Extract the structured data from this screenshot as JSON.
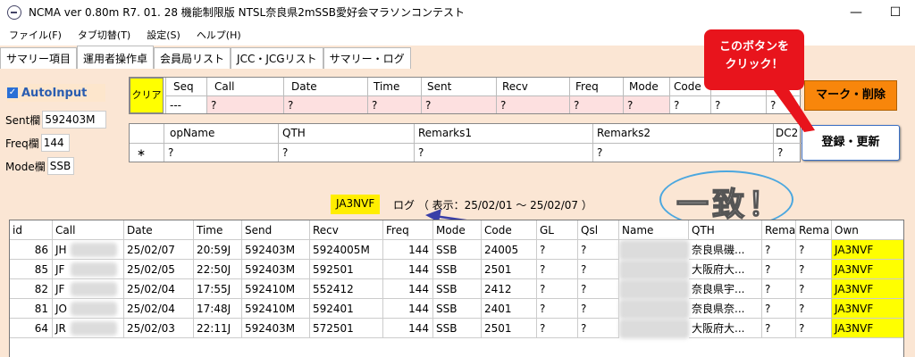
{
  "window": {
    "title": "NCMA ver 0.80m   R7. 01. 28 機能制限版 NTSL奈良県2mSSB愛好会マラソンコンテスト",
    "minimize": "—",
    "maximize": "☐"
  },
  "menu": [
    "ファイル(F)",
    "タブ切替(T)",
    "設定(S)",
    "ヘルプ(H)"
  ],
  "tabs": [
    "サマリー項目",
    "運用者操作卓",
    "会員局リスト",
    "JCC・JCGリスト",
    "サマリー・ログ"
  ],
  "left": {
    "auto_label": "AutoInput",
    "sent_label": "Sent欄",
    "sent_value": "592403M",
    "freq_label": "Freq欄",
    "freq_value": "144",
    "mode_label": "Mode欄",
    "mode_value": "SSB"
  },
  "entry": {
    "clear_label": "クリア",
    "headers": [
      "Seq",
      "Call",
      "Date",
      "Time",
      "Sent",
      "Recv",
      "Freq",
      "Mode",
      "Code",
      "",
      ""
    ],
    "values": [
      "---",
      "?",
      "?",
      "?",
      "?",
      "?",
      "?",
      "?",
      "?",
      "?",
      "?"
    ],
    "headers2": [
      "opName",
      "QTH",
      "Remarks1",
      "Remarks2",
      "DC2"
    ],
    "values2": [
      "?",
      "?",
      "?",
      "?",
      "?"
    ],
    "row_marker": "∗"
  },
  "buttons": {
    "mark_delete": "マーク・削除",
    "register_update": "登録・更新"
  },
  "callout": {
    "line1": "このボタンを",
    "line2": "クリック！"
  },
  "log": {
    "call": "JA3NVF",
    "title": "ログ  （ 表示：25/02/01 〜 25/02/07 ）"
  },
  "annotation": {
    "match_text": "一致！"
  },
  "table": {
    "columns": [
      "id",
      "Call",
      "Date",
      "Time",
      "Send",
      "Recv",
      "Freq",
      "Mode",
      "Code",
      "GL",
      "Qsl",
      "Name",
      "QTH",
      "Rema",
      "Rema",
      "Own"
    ],
    "rows": [
      [
        "86",
        "JH",
        "25/02/07",
        "20:59J",
        "592403M",
        "5924005M",
        "144",
        "SSB",
        "24005",
        "?",
        "?",
        "",
        "奈良県磯...",
        "?",
        "?",
        "JA3NVF"
      ],
      [
        "85",
        "JF",
        "25/02/05",
        "22:50J",
        "592403M",
        "592501",
        "144",
        "SSB",
        "2501",
        "?",
        "?",
        "",
        "大阪府大...",
        "?",
        "?",
        "JA3NVF"
      ],
      [
        "82",
        "JF",
        "25/02/04",
        "17:55J",
        "592410M",
        "552412",
        "144",
        "SSB",
        "2412",
        "?",
        "?",
        "",
        "奈良県宇...",
        "?",
        "?",
        "JA3NVF"
      ],
      [
        "81",
        "JO",
        "25/02/04",
        "17:48J",
        "592410M",
        "592401",
        "144",
        "SSB",
        "2401",
        "?",
        "?",
        "",
        "奈良県奈...",
        "?",
        "?",
        "JA3NVF"
      ],
      [
        "64",
        "JR",
        "25/02/03",
        "22:11J",
        "592403M",
        "572501",
        "144",
        "SSB",
        "2501",
        "?",
        "?",
        "",
        "大阪府大...",
        "?",
        "?",
        "JA3NVF"
      ]
    ]
  },
  "colors": {
    "background": "#fbe6d4",
    "highlight": "#ffff00",
    "mark_button": "#f8860b",
    "callout": "#e8141c",
    "arrow": "#3a3fa8",
    "ellipse": "#4ba7df"
  }
}
